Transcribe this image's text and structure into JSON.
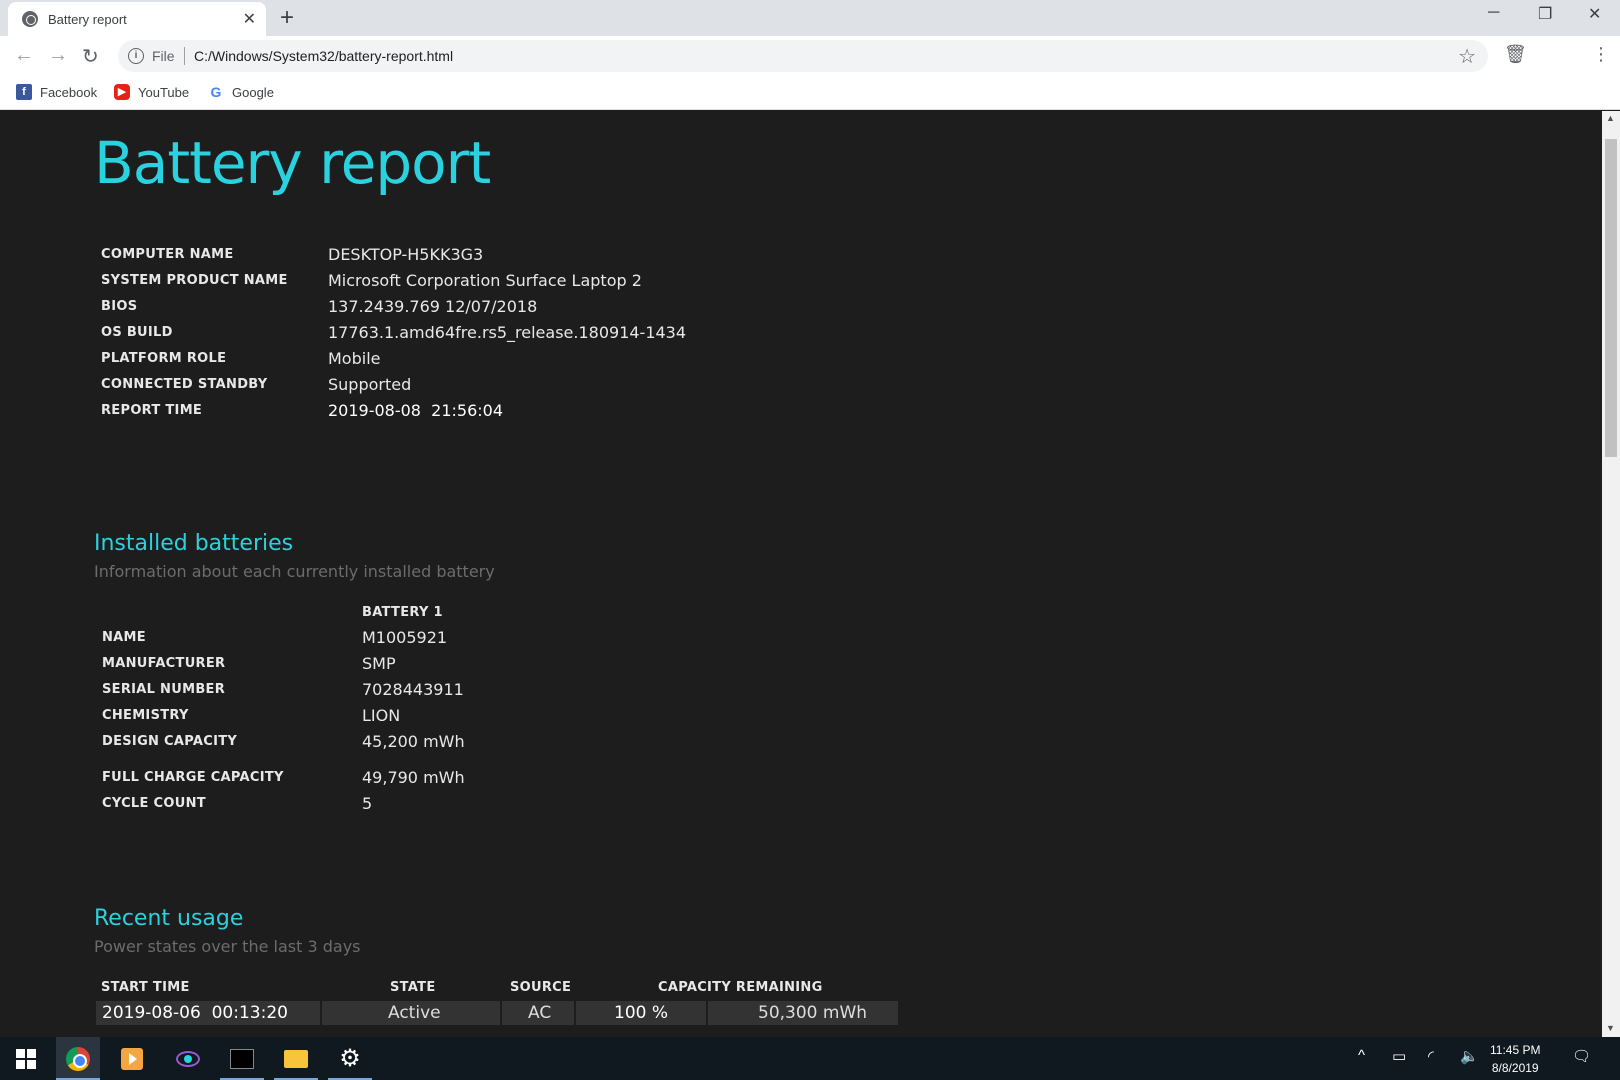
{
  "browser": {
    "tab_title": "Battery report",
    "omnibox_scheme": "File",
    "url": "C:/Windows/System32/battery-report.html",
    "bookmarks": [
      {
        "label": "Facebook",
        "icon": "facebook-icon"
      },
      {
        "label": "YouTube",
        "icon": "youtube-icon"
      },
      {
        "label": "Google",
        "icon": "google-icon"
      }
    ]
  },
  "report": {
    "title": "Battery report",
    "system": [
      {
        "label": "COMPUTER NAME",
        "value": "DESKTOP-H5KK3G3"
      },
      {
        "label": "SYSTEM PRODUCT NAME",
        "value": "Microsoft Corporation Surface Laptop 2"
      },
      {
        "label": "BIOS",
        "value": "137.2439.769 12/07/2018"
      },
      {
        "label": "OS BUILD",
        "value": "17763.1.amd64fre.rs5_release.180914-1434"
      },
      {
        "label": "PLATFORM ROLE",
        "value": "Mobile"
      },
      {
        "label": "CONNECTED STANDBY",
        "value": "Supported"
      },
      {
        "label": "REPORT TIME",
        "value": "2019-08-08  21:56:04"
      }
    ],
    "installed": {
      "heading": "Installed batteries",
      "subtitle": "Information about each currently installed battery",
      "column": "BATTERY 1",
      "rows": [
        {
          "label": "NAME",
          "value": "M1005921"
        },
        {
          "label": "MANUFACTURER",
          "value": "SMP"
        },
        {
          "label": "SERIAL NUMBER",
          "value": "7028443911"
        },
        {
          "label": "CHEMISTRY",
          "value": "LION"
        },
        {
          "label": "DESIGN CAPACITY",
          "value": "45,200 mWh"
        },
        {
          "label": "FULL CHARGE CAPACITY",
          "value": "49,790 mWh"
        },
        {
          "label": "CYCLE COUNT",
          "value": "5"
        }
      ]
    },
    "usage": {
      "heading": "Recent usage",
      "subtitle": "Power states over the last 3 days",
      "columns": [
        "START TIME",
        "STATE",
        "SOURCE",
        "CAPACITY REMAINING"
      ],
      "rows": [
        {
          "start": "2019-08-06  00:13:20",
          "state": "Active",
          "source": "AC",
          "percent": "100 %",
          "mwh": "50,300 mWh"
        }
      ]
    }
  },
  "taskbar": {
    "apps": [
      "start-button",
      "chrome-icon",
      "media-player-icon",
      "eye-app-icon",
      "terminal-icon",
      "file-explorer-icon",
      "settings-icon"
    ],
    "time": "11:45 PM",
    "date": "8/8/2019"
  }
}
